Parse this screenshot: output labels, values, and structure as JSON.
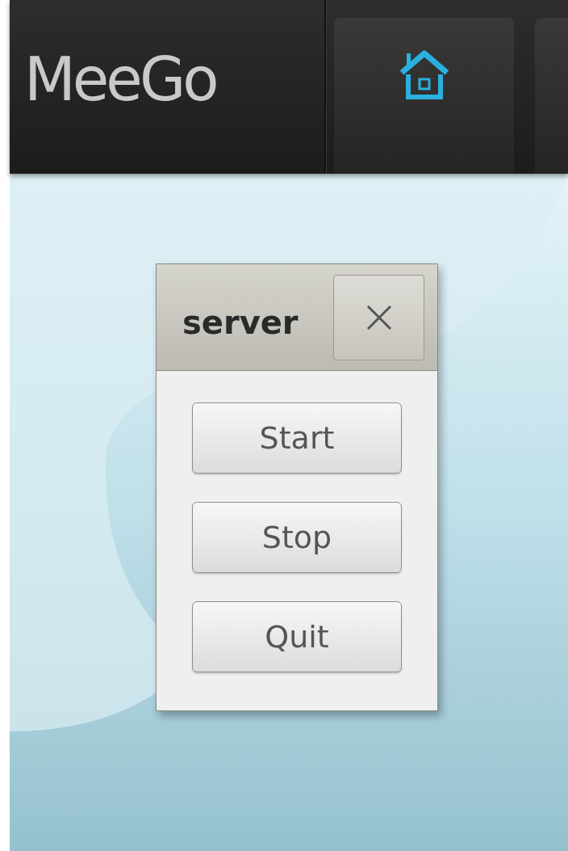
{
  "top_bar": {
    "logo": "MeeGo",
    "tabs": [
      {
        "kind": "home"
      },
      {
        "kind": "blank"
      }
    ]
  },
  "dialog": {
    "title": "server",
    "buttons": [
      "Start",
      "Stop",
      "Quit"
    ]
  }
}
